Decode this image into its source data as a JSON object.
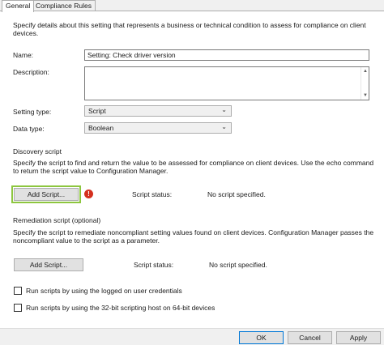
{
  "tabs": [
    {
      "label": "General",
      "active": true
    },
    {
      "label": "Compliance Rules",
      "active": false
    }
  ],
  "intro": "Specify details about this setting that represents a business or technical condition to assess for compliance on client devices.",
  "name": {
    "label": "Name:",
    "value": "Setting: Check driver version"
  },
  "description": {
    "label": "Description:",
    "value": ""
  },
  "setting_type": {
    "label": "Setting type:",
    "value": "Script"
  },
  "data_type": {
    "label": "Data type:",
    "value": "Boolean"
  },
  "discovery": {
    "heading": "Discovery script",
    "text": "Specify the script to find and return the value to be assessed for compliance on client devices. Use the echo command to return the script value to Configuration Manager.",
    "add_label": "Add Script...",
    "status_label": "Script status:",
    "status_value": "No script specified.",
    "warning_glyph": "!"
  },
  "remediation": {
    "heading": "Remediation script (optional)",
    "text": "Specify the script to remediate noncompliant setting values found on client devices. Configuration Manager passes the noncompliant value to the script as a parameter.",
    "add_label": "Add Script...",
    "status_label": "Script status:",
    "status_value": "No script specified."
  },
  "options": [
    {
      "label": "Run scripts by using the logged on user credentials",
      "checked": false
    },
    {
      "label": "Run scripts by using the 32-bit scripting host on 64-bit devices",
      "checked": false
    }
  ],
  "footer": {
    "ok": "OK",
    "cancel": "Cancel",
    "apply": "Apply"
  },
  "colors": {
    "focus_border": "#0078d7",
    "highlight": "#8dc63f",
    "error": "#d42f1e"
  }
}
